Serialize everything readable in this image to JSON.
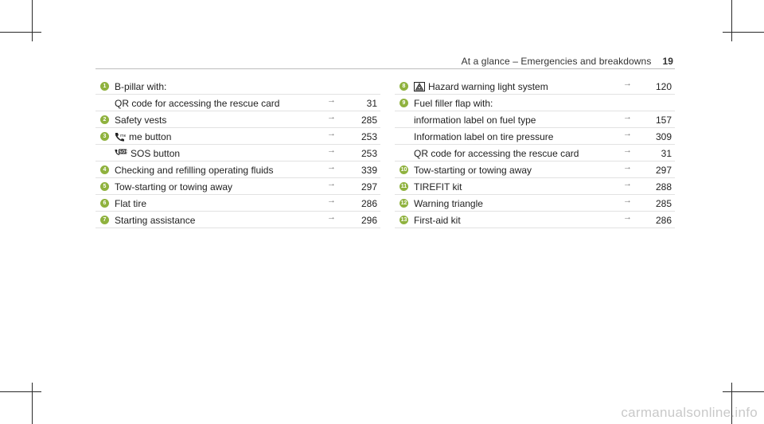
{
  "header": {
    "title": "At a glance – Emergencies and breakdowns",
    "page_number": "19"
  },
  "colors": {
    "bullet": "#8fb23e",
    "rule": "#e2e2e2"
  },
  "left_column": [
    {
      "num": "1",
      "label": "B-pillar with:",
      "page": ""
    },
    {
      "num": "",
      "label": "QR code for accessing the rescue card",
      "page": "31"
    },
    {
      "num": "2",
      "label": "Safety vests",
      "page": "285"
    },
    {
      "num": "3",
      "icon": "me-call-icon",
      "label": "me button",
      "page": "253"
    },
    {
      "num": "",
      "icon": "sos-icon",
      "label": "SOS button",
      "page": "253"
    },
    {
      "num": "4",
      "label": "Checking and refilling operating fluids",
      "page": "339"
    },
    {
      "num": "5",
      "label": "Tow-starting or towing away",
      "page": "297"
    },
    {
      "num": "6",
      "label": "Flat tire",
      "page": "286"
    },
    {
      "num": "7",
      "label": "Starting assistance",
      "page": "296"
    }
  ],
  "right_column": [
    {
      "num": "8",
      "icon": "hazard-warning-icon",
      "label": "Hazard warning light system",
      "page": "120"
    },
    {
      "num": "9",
      "label": "Fuel filler flap with:",
      "page": ""
    },
    {
      "num": "",
      "label": "information label on fuel type",
      "page": "157"
    },
    {
      "num": "",
      "label": "Information label on tire pressure",
      "page": "309"
    },
    {
      "num": "",
      "label": "QR code for accessing the rescue card",
      "page": "31"
    },
    {
      "num": "10",
      "label": "Tow-starting or towing away",
      "page": "297"
    },
    {
      "num": "11",
      "label": "TIREFIT kit",
      "page": "288"
    },
    {
      "num": "12",
      "label": "Warning triangle",
      "page": "285"
    },
    {
      "num": "13",
      "label": "First-aid kit",
      "page": "286"
    }
  ],
  "arrow_glyph": "→",
  "watermark": "carmanualsonline.info"
}
